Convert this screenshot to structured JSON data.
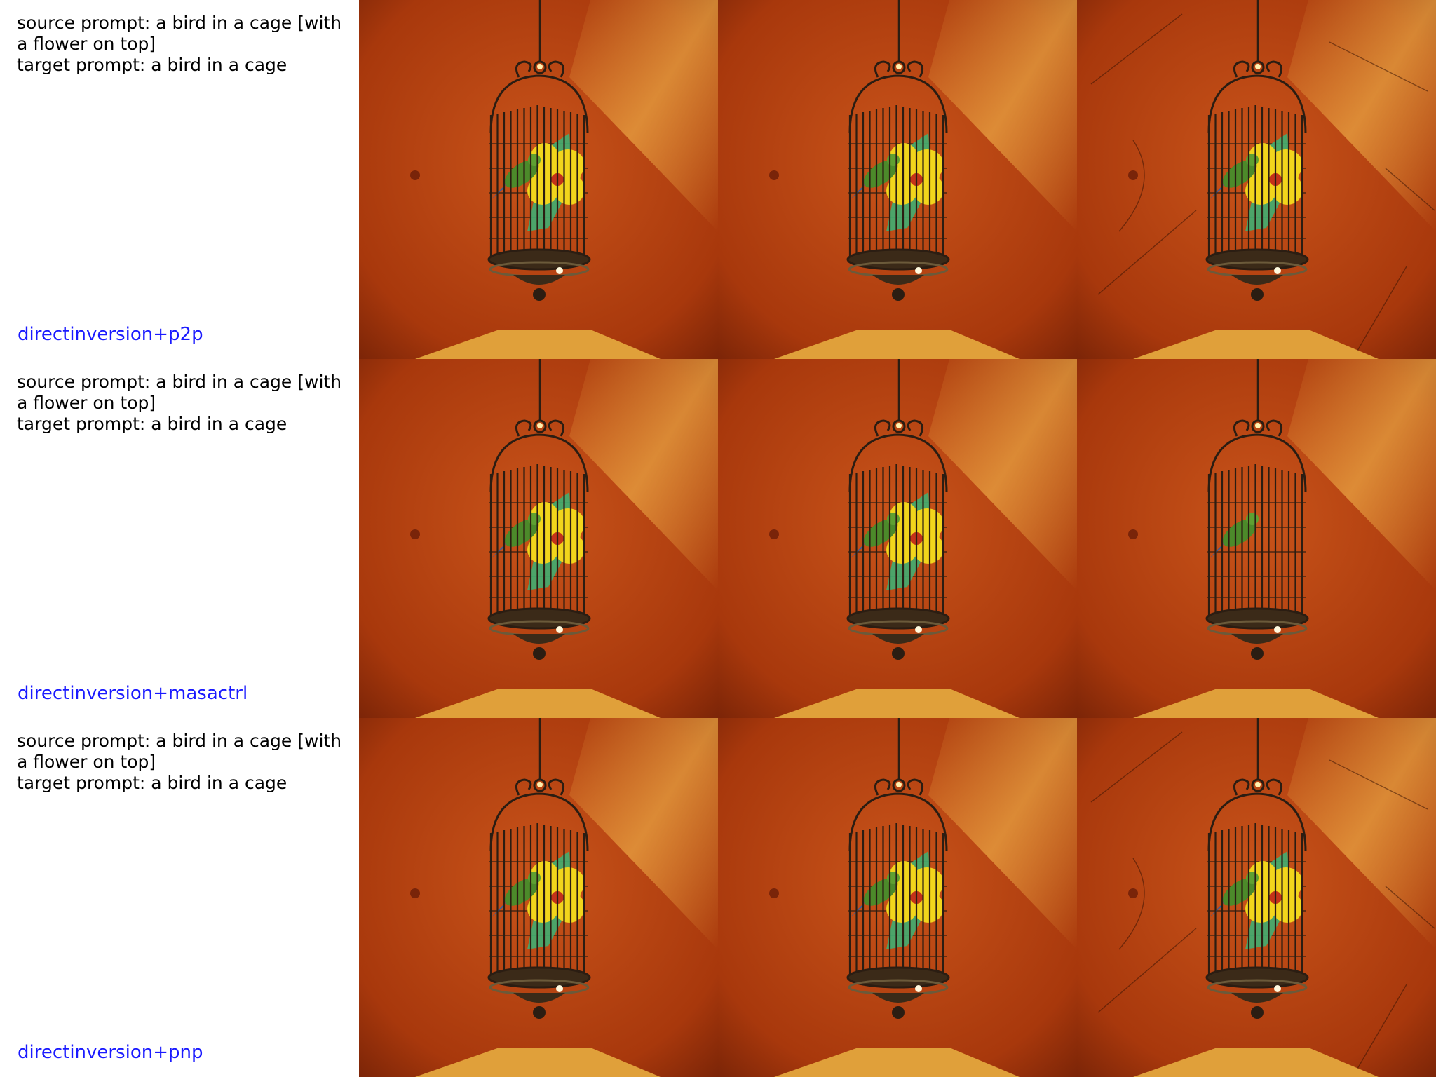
{
  "rows": [
    {
      "source_prompt": "source prompt: a bird in a cage [with a flower on top]",
      "target_prompt": "target prompt: a bird in a cage",
      "method": "directinversion+p2p",
      "images": [
        {
          "variant": "source",
          "flower": true,
          "grunge": false
        },
        {
          "variant": "edit",
          "flower": true,
          "grunge": false
        },
        {
          "variant": "edit",
          "flower": true,
          "grunge": true
        }
      ]
    },
    {
      "source_prompt": "source prompt: a bird in a cage [with a flower on top]",
      "target_prompt": "target prompt: a bird in a cage",
      "method": "directinversion+masactrl",
      "images": [
        {
          "variant": "source",
          "flower": true,
          "grunge": false
        },
        {
          "variant": "edit",
          "flower": true,
          "grunge": false
        },
        {
          "variant": "edit",
          "flower": false,
          "grunge": false
        }
      ]
    },
    {
      "source_prompt": "source prompt: a bird in a cage [with a flower on top]",
      "target_prompt": "target prompt: a bird in a cage",
      "method": "directinversion+pnp",
      "images": [
        {
          "variant": "source",
          "flower": true,
          "grunge": false
        },
        {
          "variant": "edit",
          "flower": true,
          "grunge": false
        },
        {
          "variant": "edit",
          "flower": true,
          "grunge": true
        }
      ]
    }
  ],
  "colors": {
    "background": "#b9430f",
    "light_beam": "#f2b34a",
    "floor": "#e0a03a",
    "cage": "#2b1d12",
    "flower": "#f2d51c",
    "leaf": "#3fae72",
    "bird": "#4c8a2a",
    "method_text": "#1a1aff"
  }
}
